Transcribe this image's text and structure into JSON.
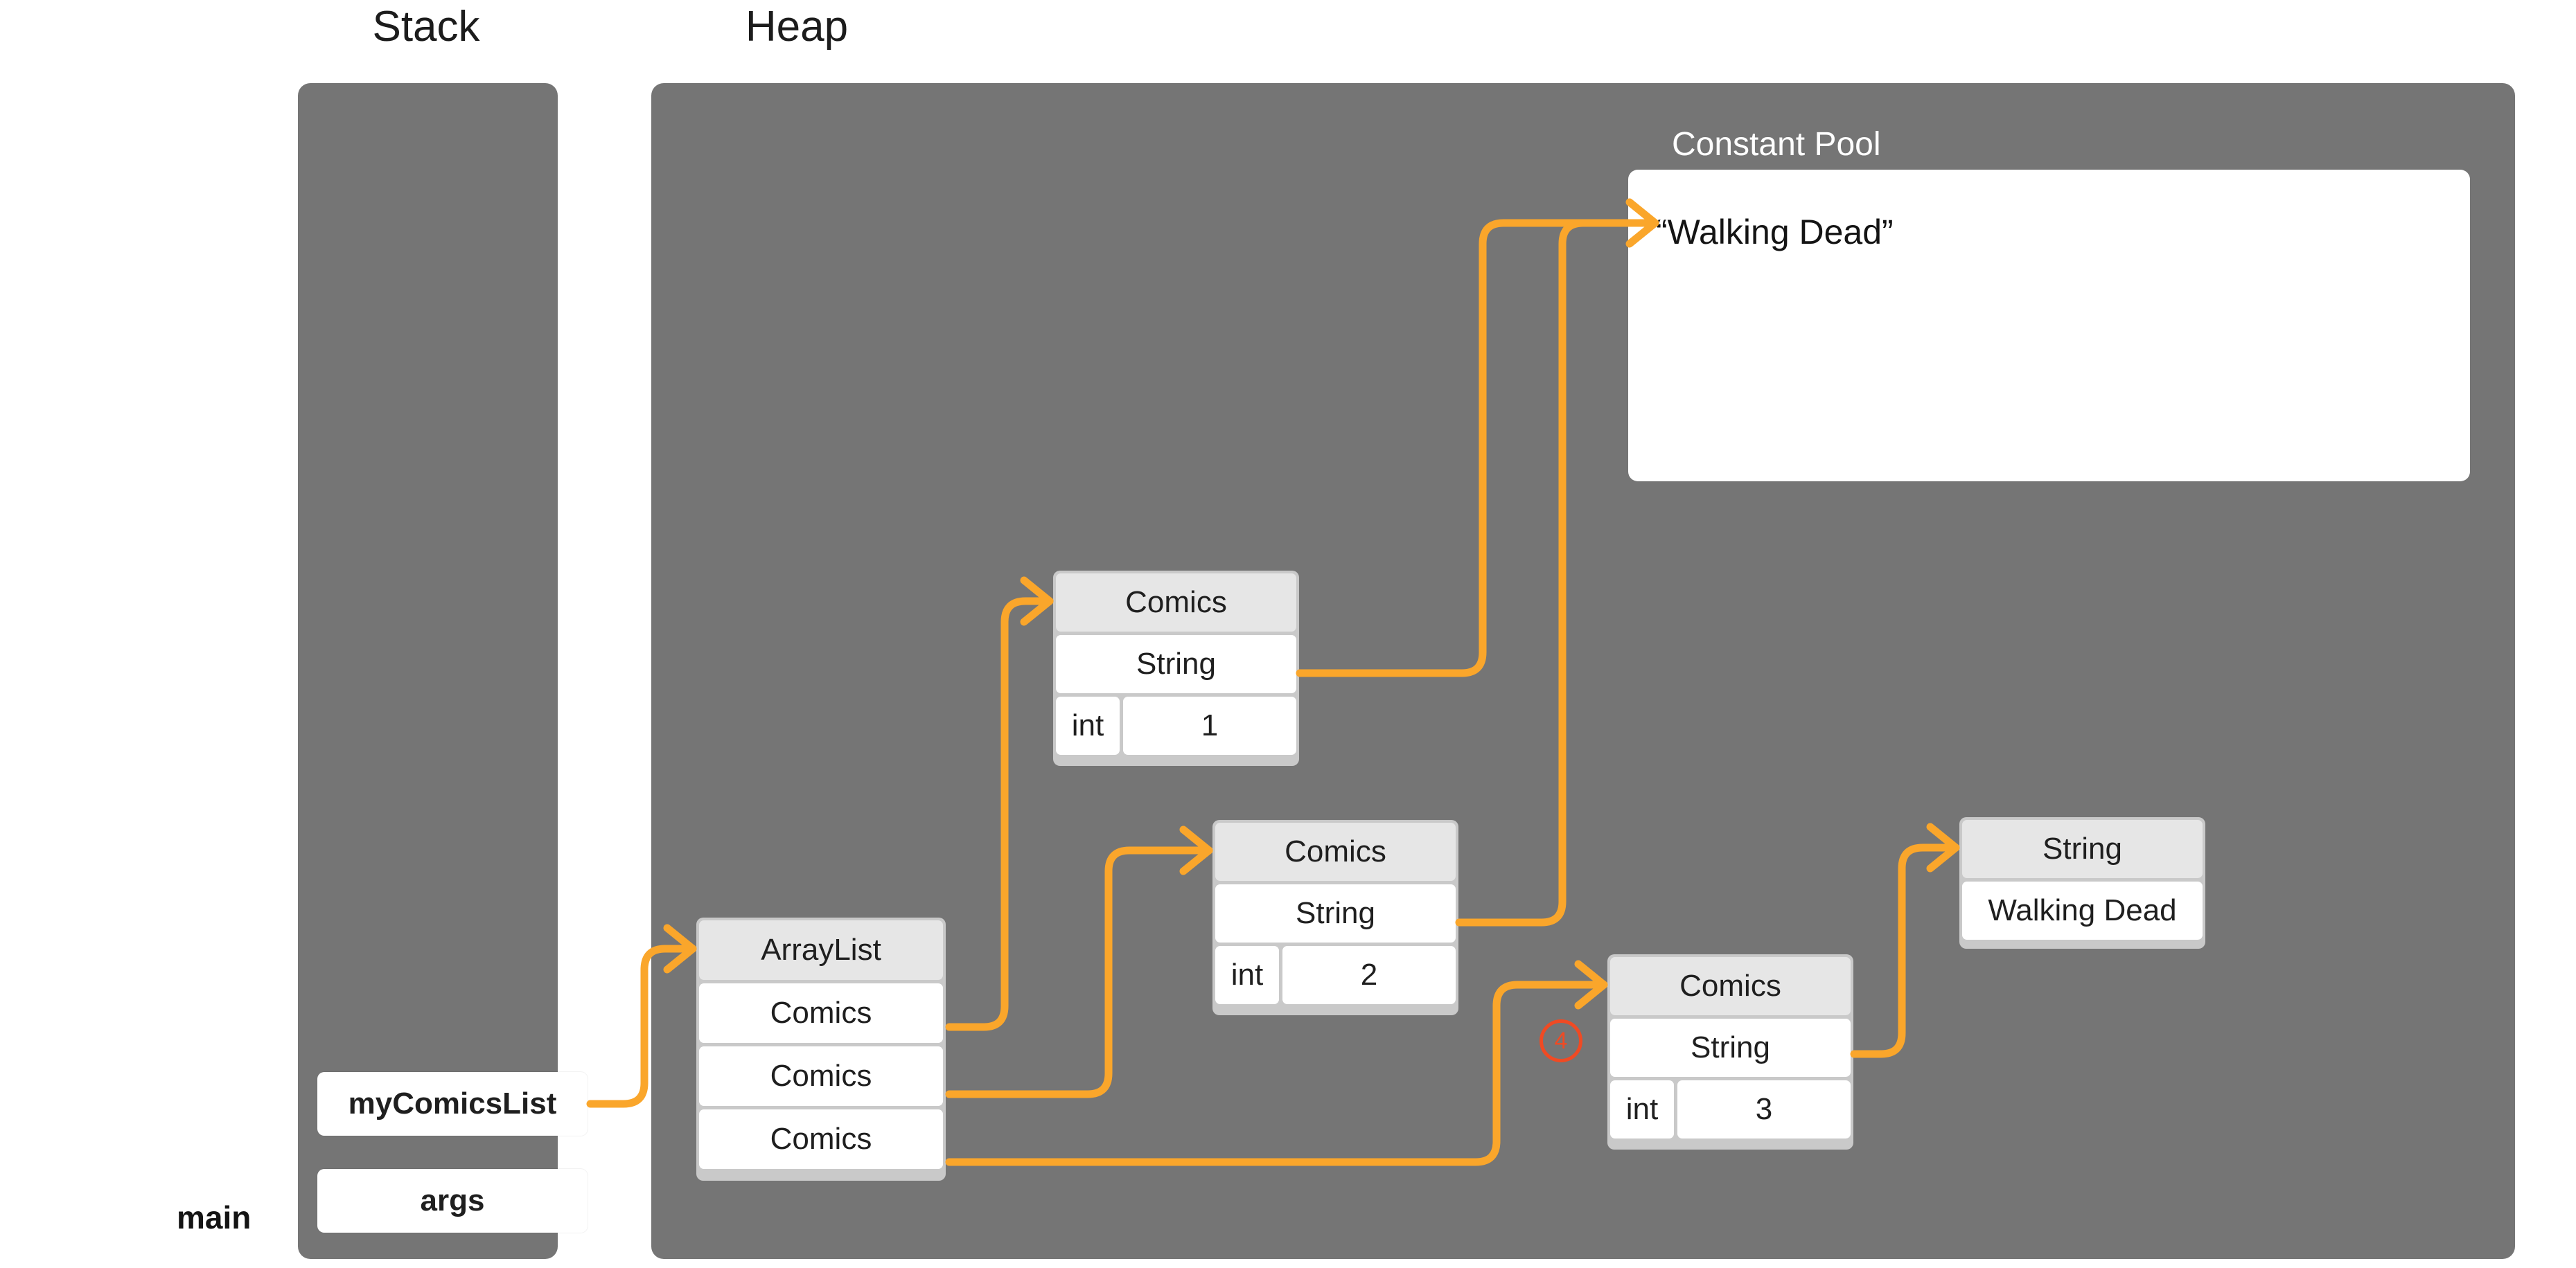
{
  "panels": {
    "stack": {
      "title": "Stack"
    },
    "heap": {
      "title": "Heap"
    }
  },
  "constant_pool": {
    "title": "Constant Pool",
    "entries": [
      "“Walking Dead”"
    ]
  },
  "stack_frame": {
    "label": "main",
    "variables": [
      {
        "name": "myComicsList"
      },
      {
        "name": "args"
      }
    ]
  },
  "heap_objects": {
    "arraylist": {
      "header": "ArrayList",
      "rows": [
        "Comics",
        "Comics",
        "Comics"
      ]
    },
    "comics1": {
      "header": "Comics",
      "ref_row": "String",
      "field_type": "int",
      "field_value": "1"
    },
    "comics2": {
      "header": "Comics",
      "ref_row": "String",
      "field_type": "int",
      "field_value": "2"
    },
    "comics3": {
      "header": "Comics",
      "ref_row": "String",
      "field_type": "int",
      "field_value": "3"
    },
    "string_obj": {
      "header": "String",
      "value": "Walking Dead"
    }
  },
  "annotations": {
    "step_marker": "4"
  },
  "colors": {
    "panel_bg": "#757575",
    "arrow": "#FAA62B",
    "marker": "#F04A23",
    "object_border": "#c9c9c9",
    "object_header": "#e6e6e6",
    "object_cell": "#ffffff",
    "text": "#1f1f1f"
  }
}
